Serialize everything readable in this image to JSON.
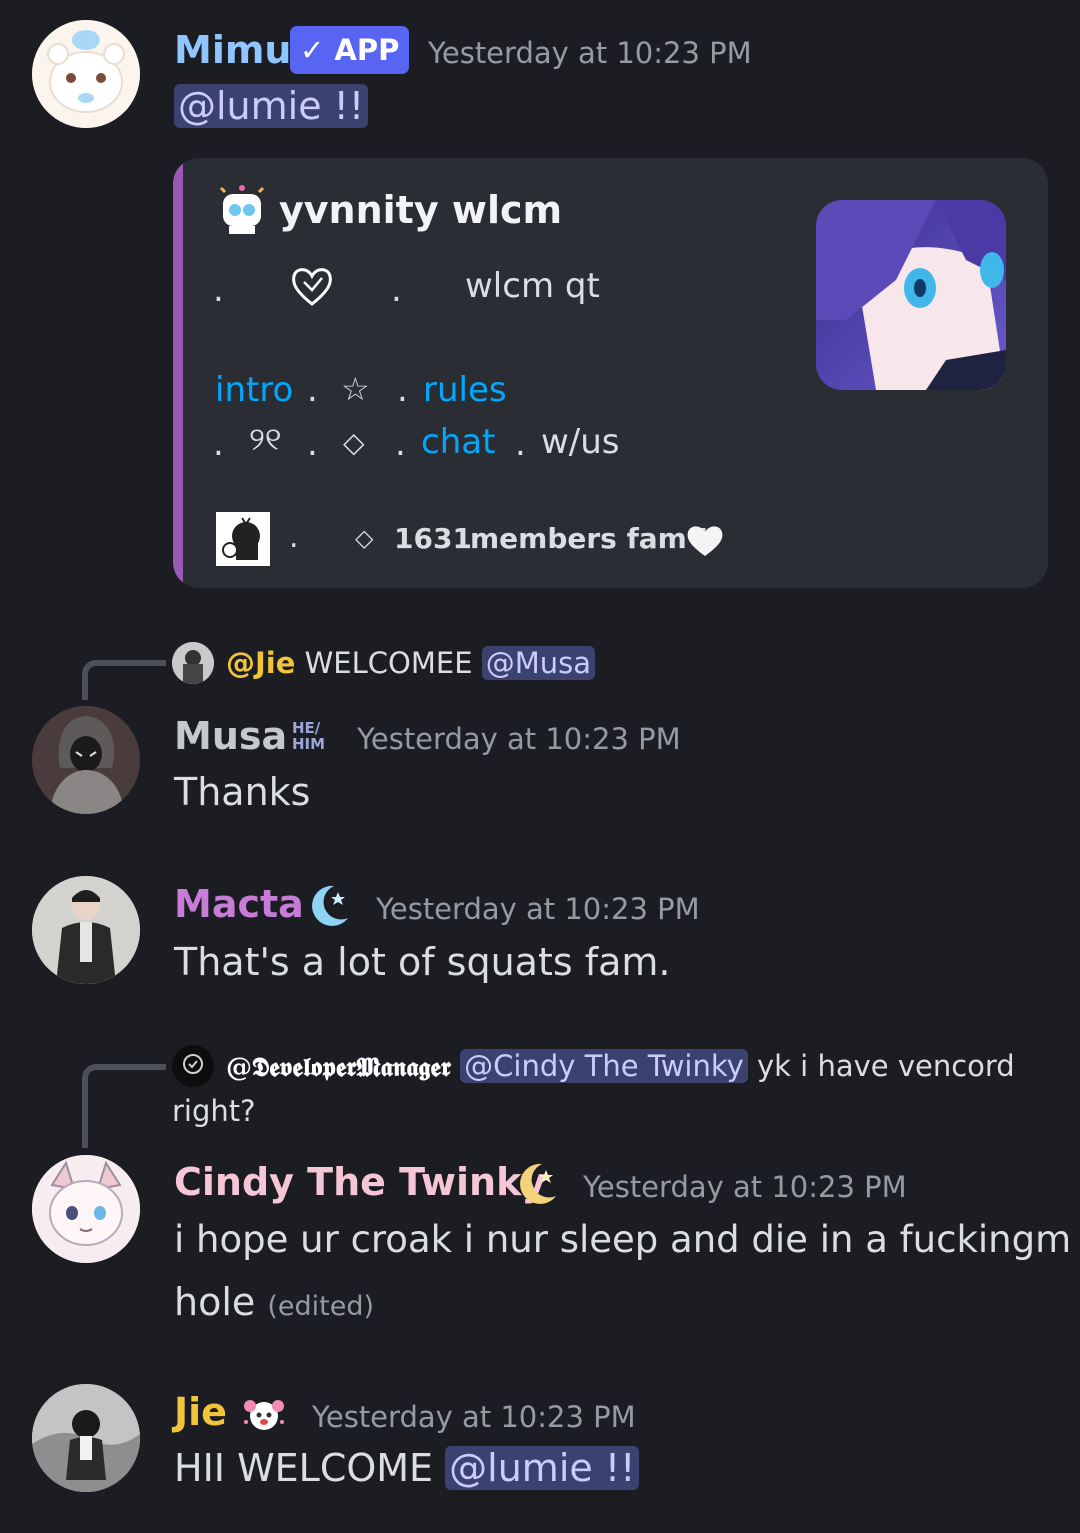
{
  "messages": {
    "mimu": {
      "username": "Mimu",
      "username_color": "#8fc6ff",
      "badge": "✓ APP",
      "timestamp": "Yesterday at 10:23 PM",
      "mention": "@lumie !!",
      "embed": {
        "accent": "#9b59b6",
        "title": "yvnnity wlcm",
        "line1_dot_a": ".",
        "line1_icon": "heart-outline-icon",
        "line1_dot_b": ".",
        "line1_text": "wlcm qt",
        "line2_link_intro": "intro",
        "line2_dot_a": ".",
        "line2_star": "☆",
        "line2_dot_b": ".",
        "line2_link_rules": "rules",
        "line3_dot_a": ".",
        "line3_glyph": "୨୧",
        "line3_dot_b": ".",
        "line3_diamond": "◇",
        "line3_dot_c": ".",
        "line3_link_chat": "chat",
        "line3_dot_d": ".",
        "line3_text": "w/us",
        "footer_dot": ".",
        "footer_diamond": "◇",
        "footer_count": "1631",
        "footer_text": "members fam !",
        "footer_heart": "🤍"
      }
    },
    "musa": {
      "reply": {
        "user": "@Jie",
        "text": "WELCOMEE",
        "mention": "@Musa"
      },
      "username": "Musa",
      "username_color": "#c4c9ce",
      "pronoun_badge_line1": "HE/",
      "pronoun_badge_line2": "HIM",
      "timestamp": "Yesterday at 10:23 PM",
      "text": "Thanks"
    },
    "macta": {
      "username": "Macta",
      "username_color": "#c77dd8",
      "icon": "crescent-moon-icon",
      "timestamp": "Yesterday at 10:23 PM",
      "text": "That's a lot of squats fam."
    },
    "cindy": {
      "reply": {
        "user": "@𝕯𝖊𝖛𝖊𝖑𝖔𝖕𝖊𝖗𝕸𝖆𝖓𝖆𝖌𝖊𝖗",
        "mention": "@Cindy The Twinky",
        "text": "yk i have vencord",
        "text_cont": "right?"
      },
      "username": "Cindy The Twinky",
      "username_color": "#f4c6d6",
      "icon": "crescent-moon-icon",
      "timestamp": "Yesterday at 10:23 PM",
      "text_line1": "i hope ur croak i nur sleep and die in a fuckingm",
      "text_line2": "hole",
      "edited": "(edited)"
    },
    "jie": {
      "username": "Jie",
      "username_color": "#f0c53a",
      "icon": "flower-mascot-icon",
      "timestamp": "Yesterday at 10:23 PM",
      "text": "HII WELCOME",
      "mention": "@lumie !!"
    }
  }
}
